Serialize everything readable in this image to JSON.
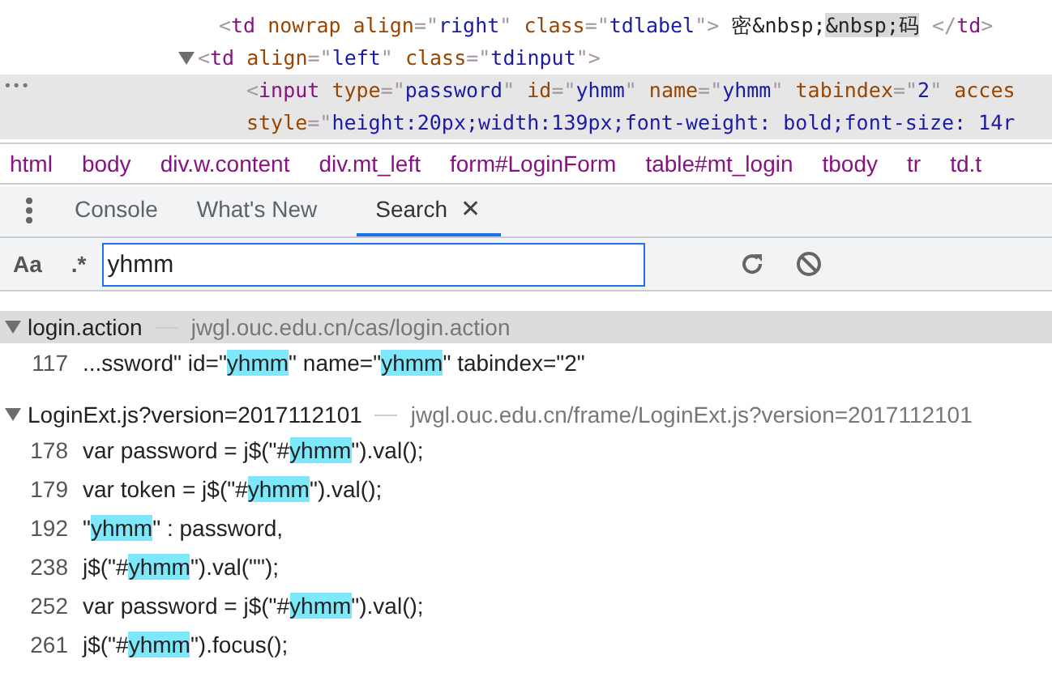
{
  "elements": [
    {
      "selected": false,
      "lines": [
        [
          {
            "kind": "punct",
            "text": "<"
          },
          {
            "kind": "tag",
            "text": "td"
          },
          {
            "kind": "attr",
            "text": " nowrap align"
          },
          {
            "kind": "punct",
            "text": "=\""
          },
          {
            "kind": "value",
            "text": "right"
          },
          {
            "kind": "punct",
            "text": "\""
          },
          {
            "kind": "attr",
            "text": " class"
          },
          {
            "kind": "punct",
            "text": "=\""
          },
          {
            "kind": "value",
            "text": "tdlabel"
          },
          {
            "kind": "punct",
            "text": "\">"
          },
          {
            "kind": "text",
            "text": " 密&nbsp;"
          },
          {
            "kind": "found",
            "text": "&nbsp;码"
          },
          {
            "kind": "punct",
            "text": " </"
          },
          {
            "kind": "tag",
            "text": "td"
          },
          {
            "kind": "punct",
            "text": ">"
          }
        ]
      ]
    },
    {
      "selected": false,
      "expanded": true,
      "lines": [
        [
          {
            "kind": "punct",
            "text": "<"
          },
          {
            "kind": "tag",
            "text": "td"
          },
          {
            "kind": "attr",
            "text": " align"
          },
          {
            "kind": "punct",
            "text": "=\""
          },
          {
            "kind": "value",
            "text": "left"
          },
          {
            "kind": "punct",
            "text": "\""
          },
          {
            "kind": "attr",
            "text": " class"
          },
          {
            "kind": "punct",
            "text": "=\""
          },
          {
            "kind": "value",
            "text": "tdinput"
          },
          {
            "kind": "punct",
            "text": "\">"
          }
        ]
      ],
      "children": [
        {
          "selected": true,
          "more": "•••",
          "lines": [
            [
              {
                "kind": "punct",
                "text": "<"
              },
              {
                "kind": "tag",
                "text": "input"
              },
              {
                "kind": "attr",
                "text": " type"
              },
              {
                "kind": "punct",
                "text": "=\""
              },
              {
                "kind": "value",
                "text": "password"
              },
              {
                "kind": "punct",
                "text": "\""
              },
              {
                "kind": "attr",
                "text": " id"
              },
              {
                "kind": "punct",
                "text": "=\""
              },
              {
                "kind": "value",
                "text": "yhmm"
              },
              {
                "kind": "punct",
                "text": "\""
              },
              {
                "kind": "attr",
                "text": " name"
              },
              {
                "kind": "punct",
                "text": "=\""
              },
              {
                "kind": "value",
                "text": "yhmm"
              },
              {
                "kind": "punct",
                "text": "\""
              },
              {
                "kind": "attr",
                "text": " tabindex"
              },
              {
                "kind": "punct",
                "text": "=\""
              },
              {
                "kind": "value",
                "text": "2"
              },
              {
                "kind": "punct",
                "text": "\""
              },
              {
                "kind": "attr",
                "text": " acces"
              }
            ],
            [
              {
                "kind": "attr",
                "text": "style"
              },
              {
                "kind": "punct",
                "text": "=\""
              },
              {
                "kind": "value",
                "text": "height:20px;width:139px;font-weight: bold;font-size: 14r"
              }
            ]
          ]
        }
      ]
    }
  ],
  "breadcrumbs": [
    "html",
    "body",
    "div.w.content",
    "div.mt_left",
    "form#LoginForm",
    "table#mt_login",
    "tbody",
    "tr",
    "td.t"
  ],
  "tabs": [
    {
      "label": "Console",
      "selected": false
    },
    {
      "label": "What's New",
      "selected": false
    },
    {
      "label": "Search",
      "selected": true,
      "close": "✕"
    }
  ],
  "search": {
    "case_toggle": "Aa",
    "regex_toggle": ".*",
    "value": "yhmm"
  },
  "results": [
    {
      "file": "login.action",
      "url": "jwgl.ouc.edu.cn/cas/login.action",
      "expanded": true,
      "lines": [
        {
          "number": "117",
          "parts": [
            {
              "text": "...ssword\" id=\"",
              "match": false
            },
            {
              "text": "yhmm",
              "match": true
            },
            {
              "text": "\" name=\"",
              "match": false
            },
            {
              "text": "yhmm",
              "match": true
            },
            {
              "text": "\" tabindex=\"2\"",
              "match": false
            }
          ]
        }
      ]
    },
    {
      "file": "LoginExt.js?version=2017112101",
      "url": "jwgl.ouc.edu.cn/frame/LoginExt.js?version=2017112101",
      "expanded": true,
      "lines": [
        {
          "number": "178",
          "parts": [
            {
              "text": "var password = j$(\"#",
              "match": false
            },
            {
              "text": "yhmm",
              "match": true
            },
            {
              "text": "\").val();",
              "match": false
            }
          ]
        },
        {
          "number": "179",
          "parts": [
            {
              "text": "var token = j$(\"#",
              "match": false
            },
            {
              "text": "yhmm",
              "match": true
            },
            {
              "text": "\").val();",
              "match": false
            }
          ]
        },
        {
          "number": "192",
          "parts": [
            {
              "text": "\"",
              "match": false
            },
            {
              "text": "yhmm",
              "match": true
            },
            {
              "text": "\" : password,",
              "match": false
            }
          ]
        },
        {
          "number": "238",
          "parts": [
            {
              "text": "j$(\"#",
              "match": false
            },
            {
              "text": "yhmm",
              "match": true
            },
            {
              "text": "\").val(\"\");",
              "match": false
            }
          ]
        },
        {
          "number": "252",
          "parts": [
            {
              "text": "var password = j$(\"#",
              "match": false
            },
            {
              "text": "yhmm",
              "match": true
            },
            {
              "text": "\").val();",
              "match": false
            }
          ]
        },
        {
          "number": "261",
          "parts": [
            {
              "text": "j$(\"#",
              "match": false
            },
            {
              "text": "yhmm",
              "match": true
            },
            {
              "text": "\").focus();",
              "match": false
            }
          ]
        }
      ]
    }
  ]
}
